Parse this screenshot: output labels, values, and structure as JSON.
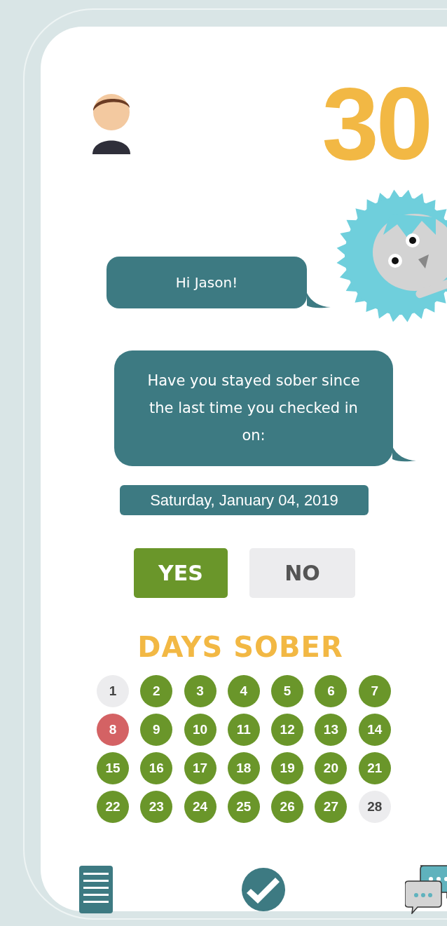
{
  "streak_count": "30",
  "messages": [
    {
      "text": "Hi Jason!"
    },
    {
      "text": "Have you stayed sober since the last time you checked in on:"
    }
  ],
  "last_check_in": "Saturday, January 04, 2019",
  "answers": [
    {
      "label": "YES",
      "selected": true
    },
    {
      "label": "NO",
      "selected": false
    }
  ],
  "days_title": "DAYS SOBER",
  "days": [
    {
      "label": "1",
      "color": "#ececee"
    },
    {
      "label": "2",
      "color": "#6a962a"
    },
    {
      "label": "3",
      "color": "#6a962a"
    },
    {
      "label": "4",
      "color": "#6a962a"
    },
    {
      "label": "5",
      "color": "#6a962a"
    },
    {
      "label": "6",
      "color": "#6a962a"
    },
    {
      "label": "7",
      "color": "#6a962a"
    },
    {
      "label": "8",
      "color": "#d46264"
    },
    {
      "label": "9",
      "color": "#6a962a"
    },
    {
      "label": "10",
      "color": "#6a962a"
    },
    {
      "label": "11",
      "color": "#6a962a"
    },
    {
      "label": "12",
      "color": "#6a962a"
    },
    {
      "label": "13",
      "color": "#6a962a"
    },
    {
      "label": "14",
      "color": "#6a962a"
    },
    {
      "label": "15",
      "color": "#6a962a"
    },
    {
      "label": "16",
      "color": "#6a962a"
    },
    {
      "label": "17",
      "color": "#6a962a"
    },
    {
      "label": "18",
      "color": "#6a962a"
    },
    {
      "label": "19",
      "color": "#6a962a"
    },
    {
      "label": "20",
      "color": "#6a962a"
    },
    {
      "label": "21",
      "color": "#6a962a"
    },
    {
      "label": "22",
      "color": "#6a962a"
    },
    {
      "label": "23",
      "color": "#6a962a"
    },
    {
      "label": "24",
      "color": "#6a962a"
    },
    {
      "label": "25",
      "color": "#6a962a"
    },
    {
      "label": "26",
      "color": "#6a962a"
    },
    {
      "label": "27",
      "color": "#6a962a"
    },
    {
      "label": "28",
      "color": "#ececee"
    }
  ]
}
